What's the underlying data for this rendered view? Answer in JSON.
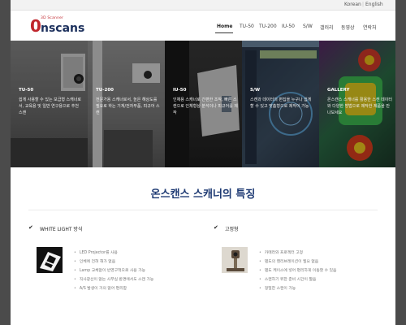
{
  "top_bar": {
    "korean": "Korean",
    "english": "English"
  },
  "logo": {
    "small": "3D Scanner",
    "zero": "0",
    "rest": "nscans"
  },
  "nav": [
    "Home",
    "TU-50",
    "TU-200",
    "IU-50",
    "S/W",
    "갤러리",
    "동영상",
    "연락처"
  ],
  "hero_panels": [
    {
      "title": "TU-50",
      "desc": "쉽게 사용할 수 있는 보급형 스캐너로서, 교육용 및 일반 연구용으로 추천 스캔"
    },
    {
      "title": "TU-200",
      "desc": "전문가용 스캐너로서, 높은 해상도를 필요로 하는 기계/전자부품, 피규어 스캔"
    },
    {
      "title": "IU-50",
      "desc": "인체용 스캐너로 간편한 조작, 빠른 스캔으로 인체형상 분석이나 피규어를 제작"
    },
    {
      "title": "S/W",
      "desc": "스캔과 데이터의 편집을 누구나 쉽게 할 수 있고 맞춤형으로 제작이 가능"
    },
    {
      "title": "GALLERY",
      "desc": "온스캔스 스캐너를 활용한 스캔 데이터와 다양한 방법으로 제작한 제품을 만나보세요"
    }
  ],
  "features": {
    "title": "온스캔스 스캐너의 특징",
    "left": {
      "heading": "WHITE LIGHT 방식",
      "icon": "check-icon",
      "items": [
        "LED Projector를 사용",
        "인체에 전혀 해가 없음",
        "Lamp 교체없이 반영구적으로 사용 가능",
        "직사광선이 없는 사무실 환경에서도 스캔 가능",
        "A/S 발생이 거의 없어 편리함"
      ]
    },
    "right": {
      "heading": "고정형",
      "icon": "check-icon",
      "items": [
        "카메라와 프로젝터 고정",
        "별도의 캘리브레이션이 필요 없음",
        "별도 케이스에 넣어 편리하게 이동할 수 있음",
        "스캔하기 위한 준비 시간이 짧음",
        "정밀한 스캔이 가능"
      ]
    }
  }
}
